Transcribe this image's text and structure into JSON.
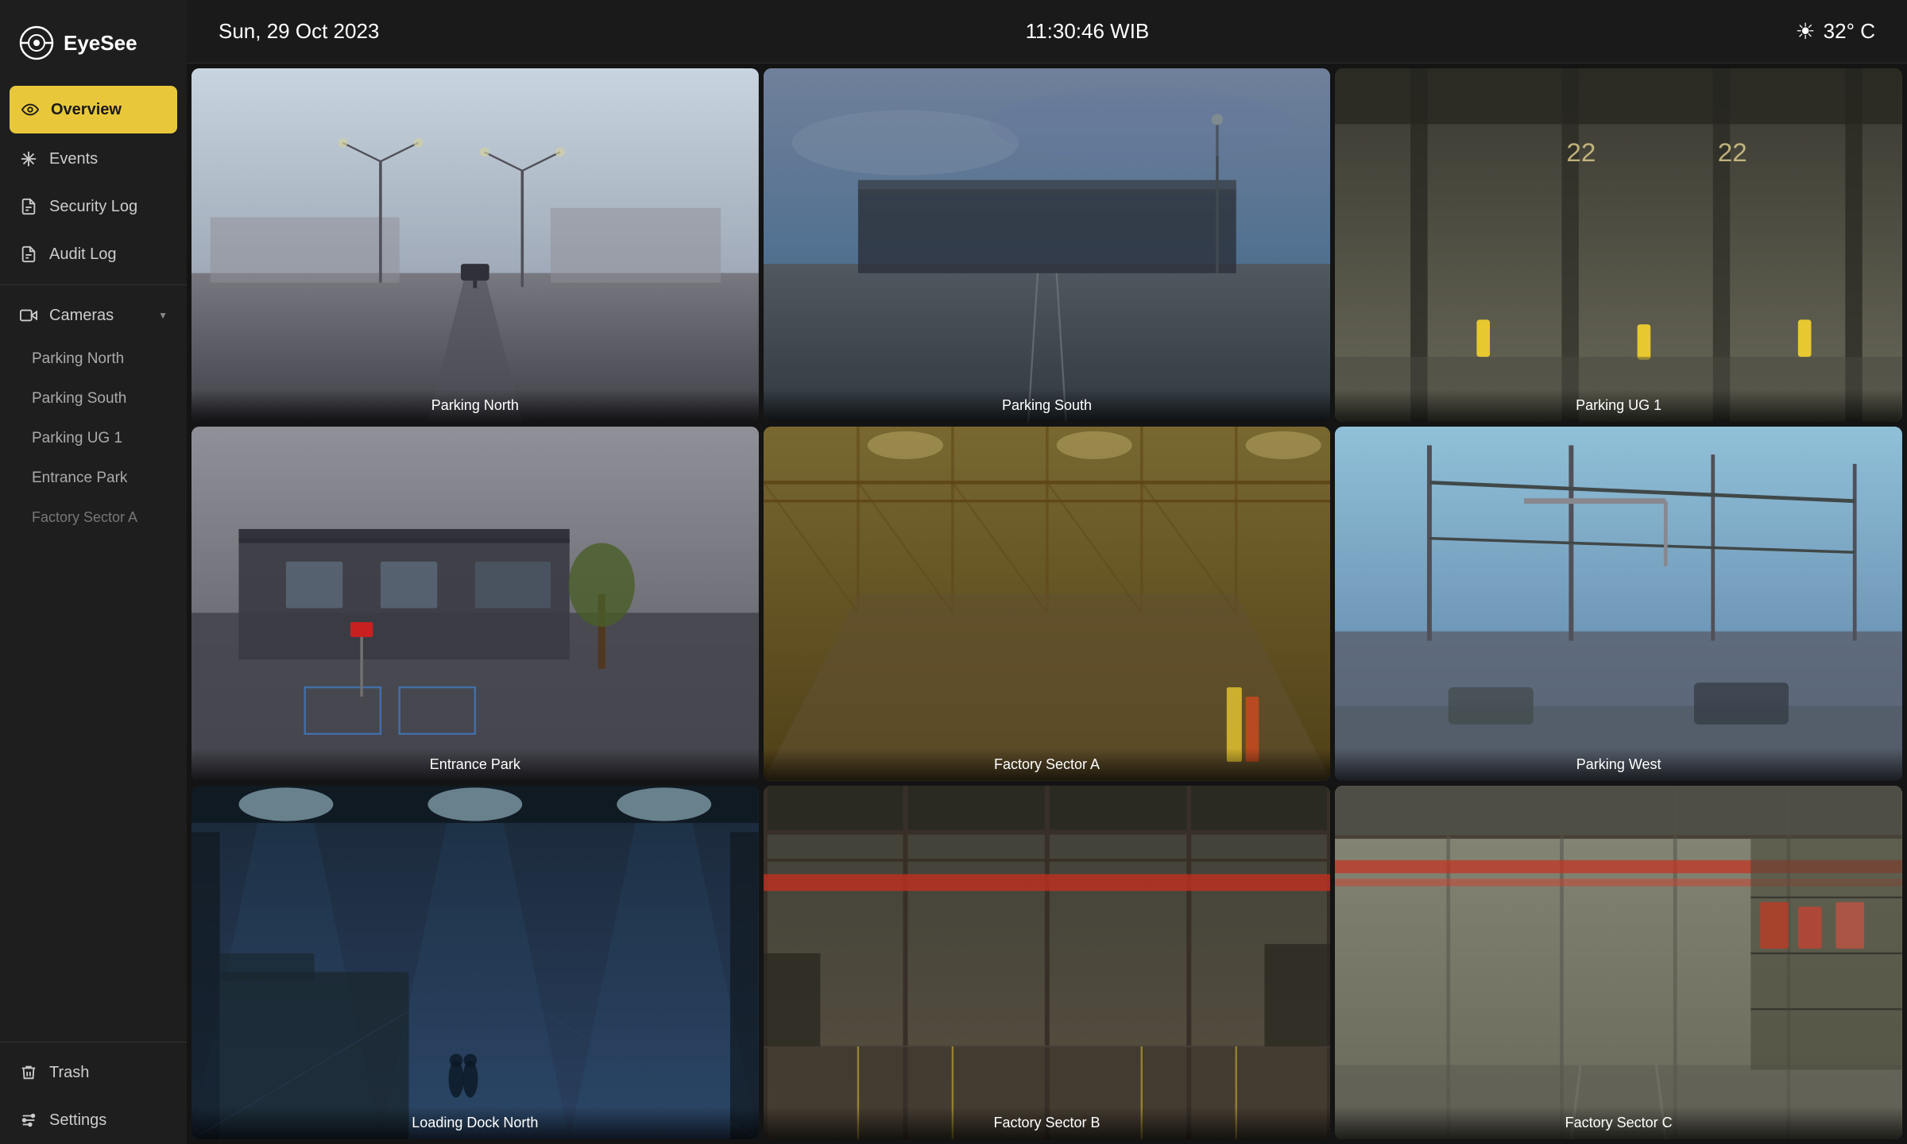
{
  "app": {
    "name": "EyeSee"
  },
  "topbar": {
    "date": "Sun, 29 Oct 2023",
    "time": "11:30:46 WIB",
    "temperature": "32° C"
  },
  "sidebar": {
    "nav_items": [
      {
        "id": "overview",
        "label": "Overview",
        "icon": "eye",
        "active": true
      },
      {
        "id": "events",
        "label": "Events",
        "icon": "asterisk"
      },
      {
        "id": "security-log",
        "label": "Security Log",
        "icon": "document"
      },
      {
        "id": "audit-log",
        "label": "Audit Log",
        "icon": "document"
      }
    ],
    "cameras_label": "Cameras",
    "camera_items": [
      {
        "id": "parking-north",
        "label": "Parking North"
      },
      {
        "id": "parking-south",
        "label": "Parking South"
      },
      {
        "id": "parking-ug1",
        "label": "Parking UG 1"
      },
      {
        "id": "entrance-park",
        "label": "Entrance Park"
      },
      {
        "id": "factory-sector-a",
        "label": "Factory Sector A"
      }
    ],
    "bottom_items": [
      {
        "id": "trash",
        "label": "Trash",
        "icon": "trash"
      },
      {
        "id": "settings",
        "label": "Settings",
        "icon": "settings"
      }
    ]
  },
  "camera_feeds": [
    {
      "id": "parking-north",
      "label": "Parking North",
      "position": 1
    },
    {
      "id": "parking-south",
      "label": "Parking South",
      "position": 2
    },
    {
      "id": "parking-ug1",
      "label": "Parking UG 1",
      "position": 3
    },
    {
      "id": "entrance-park",
      "label": "Entrance Park",
      "position": 4
    },
    {
      "id": "factory-sector-a",
      "label": "Factory Sector A",
      "position": 5
    },
    {
      "id": "parking-west",
      "label": "Parking West",
      "position": 6
    },
    {
      "id": "loading-dock-north",
      "label": "Loading Dock North",
      "position": 7
    },
    {
      "id": "factory-sector-b",
      "label": "Factory Sector B",
      "position": 8
    },
    {
      "id": "factory-sector-c",
      "label": "Factory Sector C",
      "position": 9
    }
  ]
}
